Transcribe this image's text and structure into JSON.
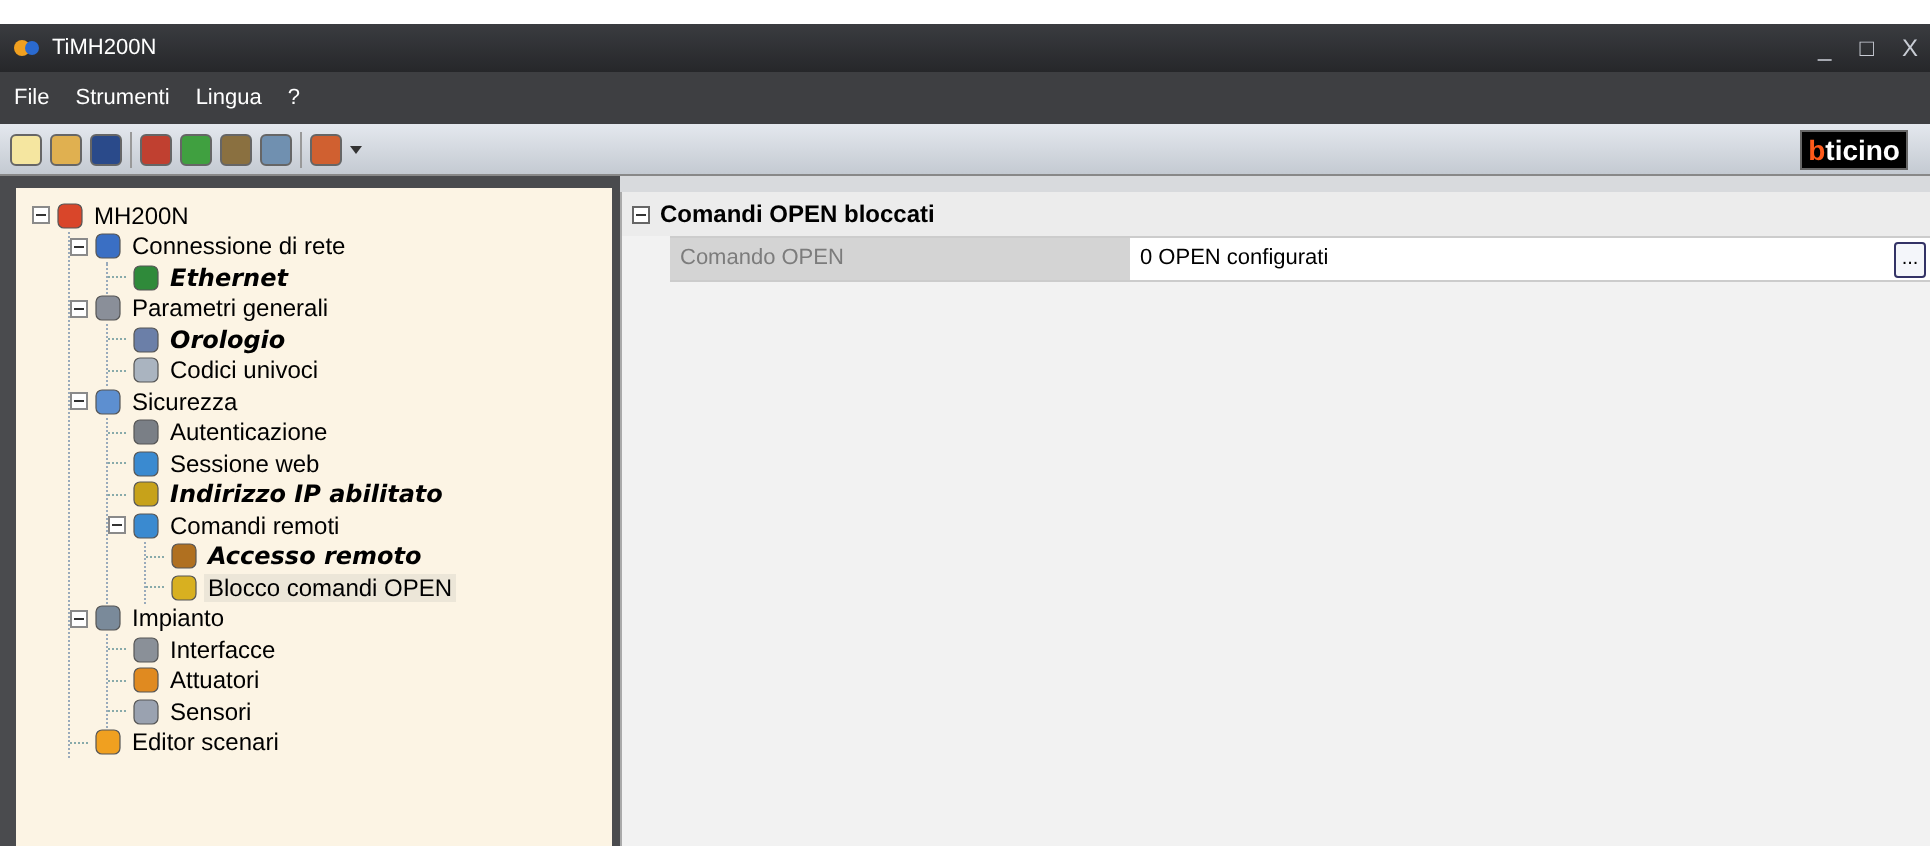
{
  "window": {
    "title": "TiMH200N",
    "controls": [
      "_",
      "□",
      "X"
    ]
  },
  "menu": [
    "File",
    "Strumenti",
    "Lingua",
    "?"
  ],
  "logo": {
    "accent": "b",
    "rest": "ticino"
  },
  "tree": [
    {
      "label": "MH200N",
      "bold": false,
      "selected": false,
      "expanded": true,
      "children": [
        {
          "label": "Connessione di rete",
          "bold": false,
          "selected": false,
          "expanded": true,
          "children": [
            {
              "label": "Ethernet",
              "bold": true,
              "selected": false
            }
          ]
        },
        {
          "label": "Parametri generali",
          "bold": false,
          "selected": false,
          "expanded": true,
          "children": [
            {
              "label": "Orologio",
              "bold": true,
              "selected": false
            },
            {
              "label": "Codici univoci",
              "bold": false,
              "selected": false
            }
          ]
        },
        {
          "label": "Sicurezza",
          "bold": false,
          "selected": false,
          "expanded": true,
          "children": [
            {
              "label": "Autenticazione",
              "bold": false,
              "selected": false
            },
            {
              "label": "Sessione web",
              "bold": false,
              "selected": false
            },
            {
              "label": "Indirizzo IP abilitato",
              "bold": true,
              "selected": false
            },
            {
              "label": "Comandi remoti",
              "bold": false,
              "selected": false,
              "expanded": true,
              "children": [
                {
                  "label": "Accesso remoto",
                  "bold": true,
                  "selected": false
                },
                {
                  "label": "Blocco comandi OPEN",
                  "bold": false,
                  "selected": true
                }
              ]
            }
          ]
        },
        {
          "label": "Impianto",
          "bold": false,
          "selected": false,
          "expanded": true,
          "children": [
            {
              "label": "Interfacce",
              "bold": false,
              "selected": false
            },
            {
              "label": "Attuatori",
              "bold": false,
              "selected": false
            },
            {
              "label": "Sensori",
              "bold": false,
              "selected": false
            }
          ]
        },
        {
          "label": "Editor scenari",
          "bold": false,
          "selected": false
        }
      ]
    }
  ],
  "properties": {
    "category": "Comandi OPEN bloccati",
    "expanded": true,
    "rows": [
      {
        "name": "Comando OPEN",
        "value": "0 OPEN configurati",
        "disabled": true,
        "button": "..."
      }
    ]
  }
}
